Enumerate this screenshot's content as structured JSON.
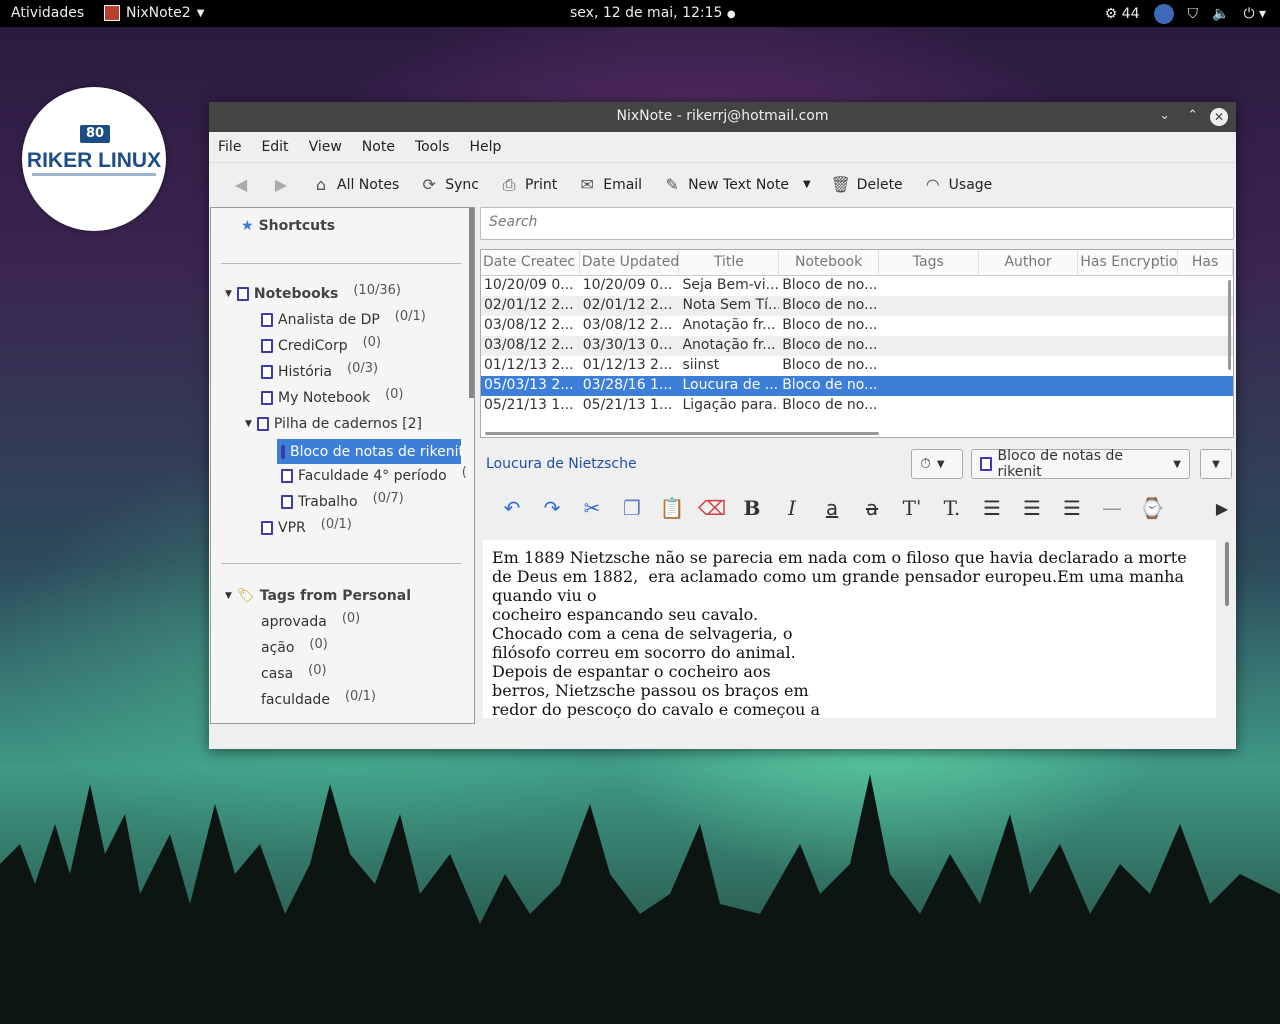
{
  "topbar": {
    "activities": "Atividades",
    "app_name": "NixNote2",
    "clock": "sex, 12 de mai, 12:15",
    "badge_count": "44"
  },
  "logo": {
    "badge": "80",
    "name": "RIKER LINUX"
  },
  "window": {
    "title": "NixNote - rikerrj@hotmail.com"
  },
  "menu": [
    "File",
    "Edit",
    "View",
    "Note",
    "Tools",
    "Help"
  ],
  "toolbar": {
    "all_notes": "All Notes",
    "sync": "Sync",
    "print": "Print",
    "email": "Email",
    "new_text_note": "New Text Note",
    "delete": "Delete",
    "usage": "Usage"
  },
  "sidebar": {
    "shortcuts": "Shortcuts",
    "notebooks": {
      "label": "Notebooks",
      "count": "(10/36)"
    },
    "items": [
      {
        "label": "Analista de DP",
        "count": "(0/1)"
      },
      {
        "label": "CrediCorp",
        "count": "(0)"
      },
      {
        "label": "História",
        "count": "(0/3)"
      },
      {
        "label": "My Notebook",
        "count": "(0)"
      },
      {
        "label": "Pilha de cadernos [2]",
        "count": ""
      },
      {
        "label": "Bloco de notas de rikenit",
        "count": ""
      },
      {
        "label": "Faculdade 4° período",
        "count": "("
      },
      {
        "label": "Trabalho",
        "count": "(0/7)"
      },
      {
        "label": "VPR",
        "count": "(0/1)"
      }
    ],
    "tags_header": "Tags from Personal",
    "tags": [
      {
        "label": "aprovada",
        "count": "(0)"
      },
      {
        "label": "ação",
        "count": "(0)"
      },
      {
        "label": "casa",
        "count": "(0)"
      },
      {
        "label": "faculdade",
        "count": "(0/1)"
      }
    ]
  },
  "search": {
    "placeholder": "Search"
  },
  "table": {
    "columns": [
      "Date Createc",
      "Date Updated",
      "Title",
      "Notebook",
      "Tags",
      "Author",
      "Has Encryption",
      "Has"
    ],
    "rows": [
      [
        "10/20/09 0...",
        "10/20/09 0...",
        "Seja Bem-vi...",
        "Bloco de no..."
      ],
      [
        "02/01/12 2...",
        "02/01/12 2...",
        "Nota Sem Tí...",
        "Bloco de no..."
      ],
      [
        "03/08/12 2...",
        "03/08/12 2...",
        "Anotação fr...",
        "Bloco de no..."
      ],
      [
        "03/08/12 2...",
        "03/30/13 0...",
        "Anotação fr...",
        "Bloco de no..."
      ],
      [
        "01/12/13 2...",
        "01/12/13 2...",
        "siinst",
        "Bloco de no..."
      ],
      [
        "05/03/13 2...",
        "03/28/16 1...",
        "Loucura de ...",
        "Bloco de no..."
      ],
      [
        "05/21/13 1...",
        "05/21/13 1...",
        "Ligação para...",
        "Bloco de no..."
      ]
    ],
    "selected_row": 5
  },
  "note": {
    "title": "Loucura de Nietzsche",
    "notebook": "Bloco de notas de rikenit",
    "body": "Em 1889 Nietzsche não se parecia em nada com o filoso que havia declarado a morte\nde Deus em 1882,  era aclamado como um grande pensador europeu.Em uma manha\nquando viu o\ncocheiro espancando seu cavalo.\nChocado com a cena de selvageria, o\nfilósofo correu em socorro do animal.\nDepois de espantar o cocheiro aos\nberros, Nietzsche passou os braços em\nredor do pescoço do cavalo e começou a"
  }
}
